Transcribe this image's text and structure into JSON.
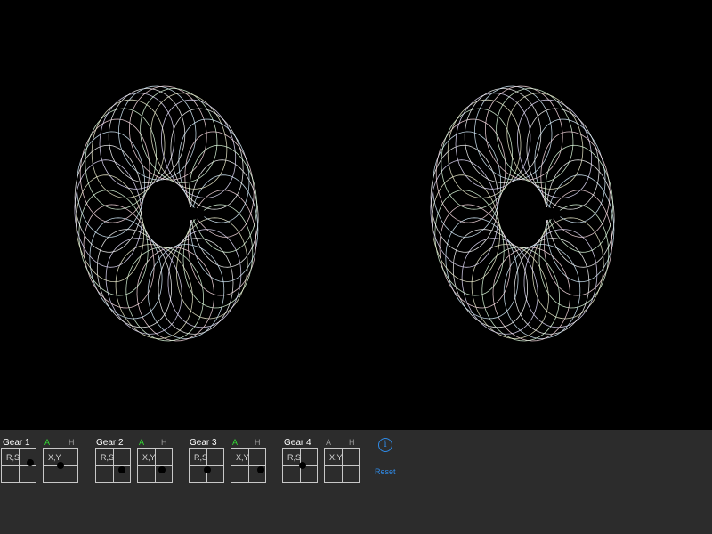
{
  "colors": {
    "canvas_background": "#000000",
    "panel_background": "#2c2c2c",
    "pad_border": "#c8c8c8",
    "flag_active": "#33dd33",
    "flag_inactive": "#9a9a9a",
    "link_blue": "#2f8be8"
  },
  "gears": [
    {
      "title": "Gear 1",
      "flag_a": "A",
      "flag_h": "H",
      "a_active": true,
      "h_active": false,
      "pad1_label": "R,S",
      "pad2_label": "X,Y"
    },
    {
      "title": "Gear 2",
      "flag_a": "A",
      "flag_h": "H",
      "a_active": true,
      "h_active": false,
      "pad1_label": "R,S",
      "pad2_label": "X,Y"
    },
    {
      "title": "Gear 3",
      "flag_a": "A",
      "flag_h": "H",
      "a_active": true,
      "h_active": false,
      "pad1_label": "R,S",
      "pad2_label": "X,Y"
    },
    {
      "title": "Gear 4",
      "flag_a": "A",
      "flag_h": "H",
      "a_active": false,
      "h_active": false,
      "pad1_label": "R,S",
      "pad2_label": "X,Y"
    }
  ],
  "info_icon": "info-icon",
  "info_glyph": "i",
  "reset_label": "Reset"
}
